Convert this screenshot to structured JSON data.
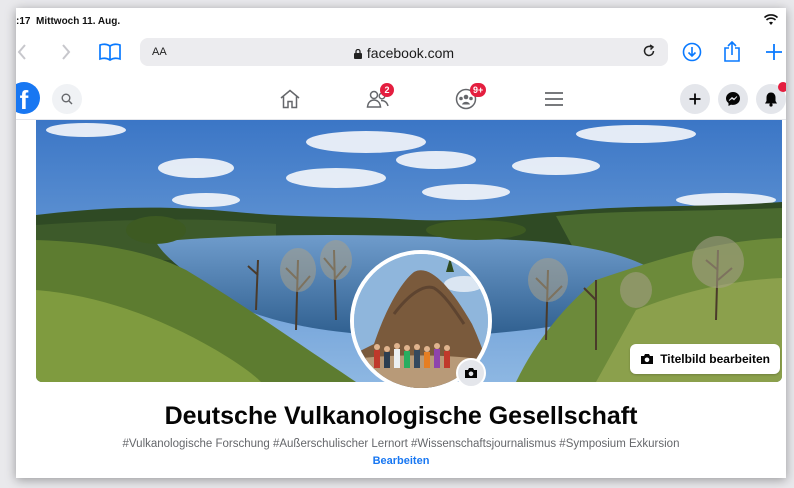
{
  "status_bar": {
    "time": ":17",
    "date": "Mittwoch 11. Aug."
  },
  "browser": {
    "text_size_label": "AA",
    "domain": "facebook.com"
  },
  "fb_nav": {
    "friends_badge": "2",
    "groups_badge": "9+"
  },
  "cover": {
    "edit_label": "Titelbild bearbeiten"
  },
  "page": {
    "title": "Deutsche Vulkanologische Gesellschaft",
    "tags": "#Vulkanologische Forschung #Außerschulischer Lernort #Wissenschaftsjournalismus #Symposium Exkursion",
    "edit_link": "Bearbeiten"
  },
  "colors": {
    "fb_blue": "#1877f2",
    "badge_red": "#e41e3f",
    "safari_blue": "#0a7aff"
  },
  "icons": [
    "wifi-icon",
    "back-icon",
    "forward-icon",
    "bookmarks-icon",
    "lock-icon",
    "reload-icon",
    "download-icon",
    "share-icon",
    "new-tab-icon",
    "facebook-logo",
    "search-icon",
    "home-icon",
    "friends-icon",
    "groups-icon",
    "menu-icon",
    "plus-icon",
    "messenger-icon",
    "bell-icon",
    "camera-icon"
  ]
}
